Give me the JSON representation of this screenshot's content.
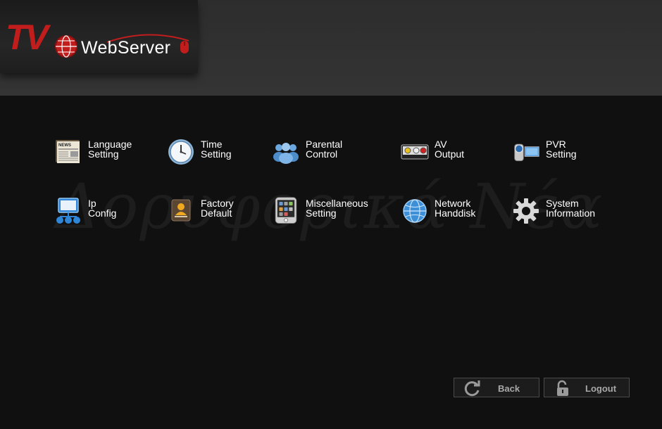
{
  "logo": {
    "brand": "TV",
    "product": "WebServer"
  },
  "watermark": "Δορυφορικά Νέα",
  "menu": [
    {
      "id": "language-setting",
      "line1": "Language",
      "line2": "Setting",
      "icon": "newspaper-icon"
    },
    {
      "id": "time-setting",
      "line1": "Time",
      "line2": "Setting",
      "icon": "clock-icon"
    },
    {
      "id": "parental-control",
      "line1": "Parental",
      "line2": "Control",
      "icon": "people-icon"
    },
    {
      "id": "av-output",
      "line1": "AV",
      "line2": "Output",
      "icon": "av-connector-icon"
    },
    {
      "id": "pvr-setting",
      "line1": "PVR",
      "line2": "Setting",
      "icon": "camcorder-icon"
    },
    {
      "id": "ip-config",
      "line1": "Ip",
      "line2": "Config",
      "icon": "network-monitor-icon"
    },
    {
      "id": "factory-default",
      "line1": "Factory",
      "line2": "Default",
      "icon": "contact-card-icon"
    },
    {
      "id": "miscellaneous-setting",
      "line1": "Miscellaneous",
      "line2": "Setting",
      "icon": "tablet-apps-icon"
    },
    {
      "id": "network-handdisk",
      "line1": "Network",
      "line2": "Handdisk",
      "icon": "globe-icon"
    },
    {
      "id": "system-information",
      "line1": "System",
      "line2": "Information",
      "icon": "gear-icon"
    }
  ],
  "buttons": {
    "back": "Back",
    "logout": "Logout"
  },
  "colors": {
    "brand_red": "#c21d1d",
    "background": "#101010",
    "header": "#313131"
  }
}
